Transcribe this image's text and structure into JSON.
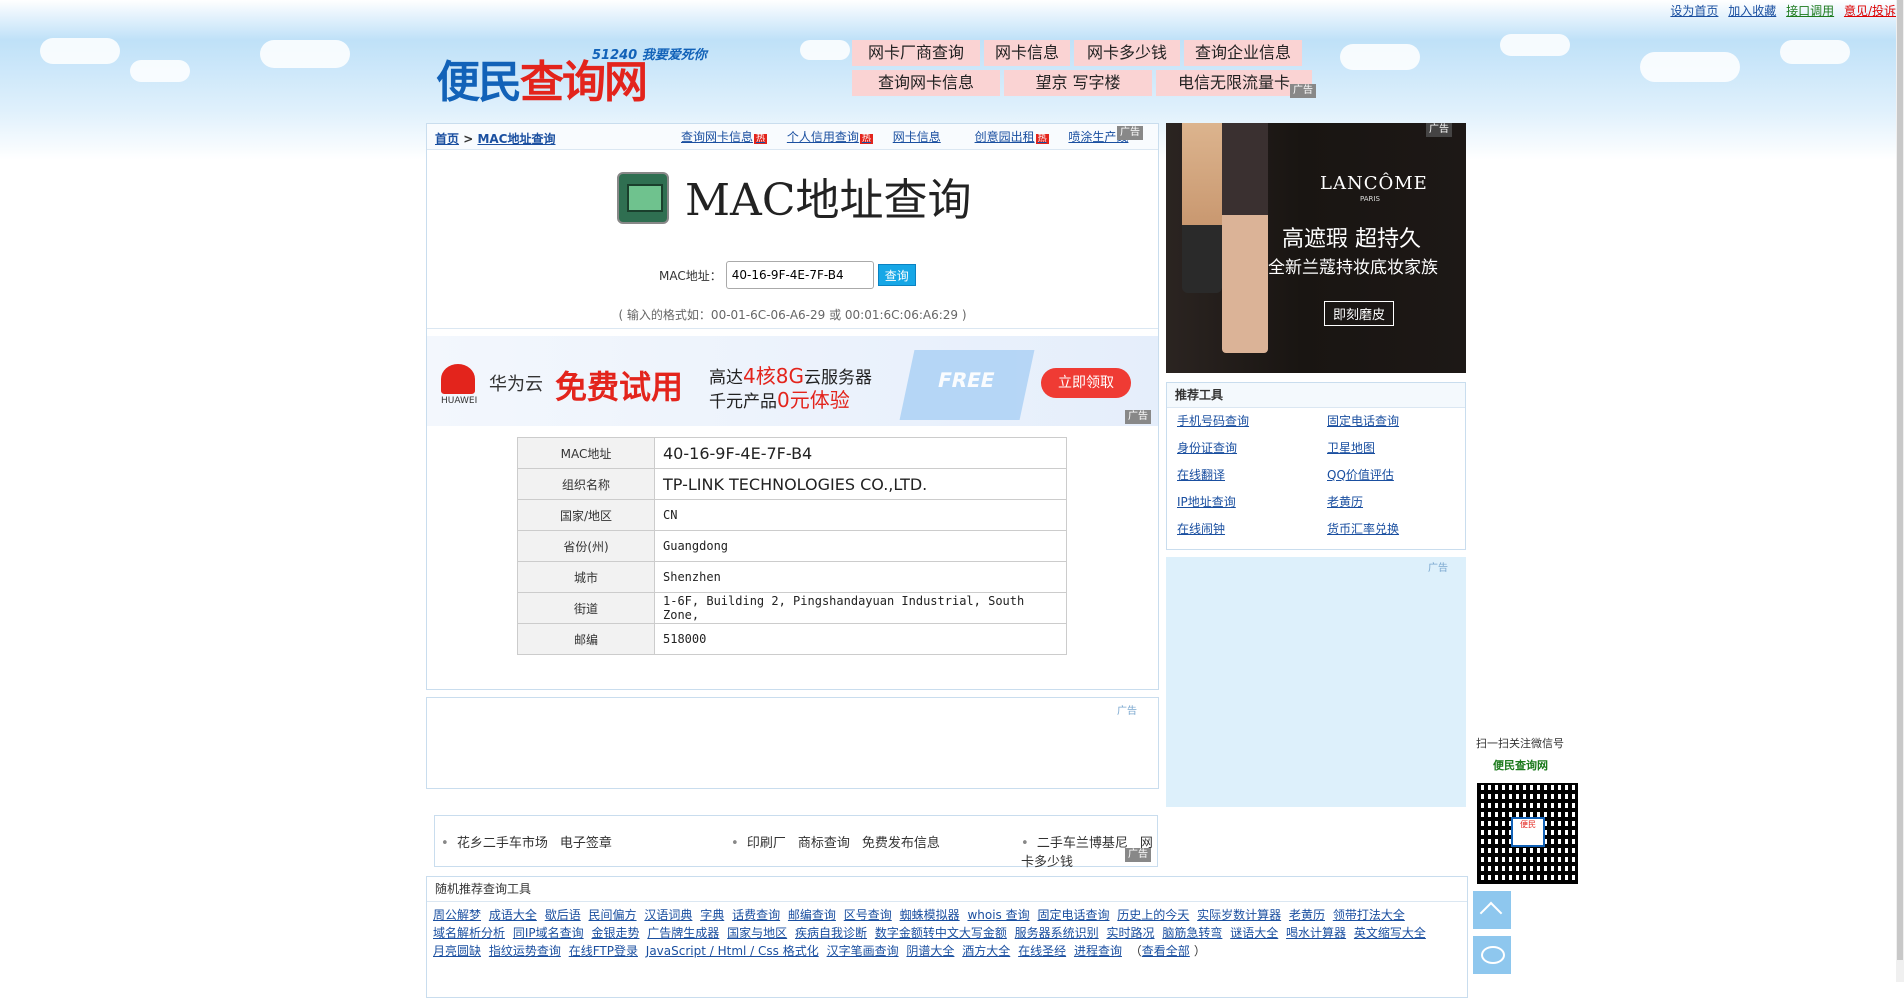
{
  "toplinks": {
    "home": "设为首页",
    "fav": "加入收藏",
    "api": "接口调用",
    "feedback": "意见/投诉"
  },
  "logo": {
    "slogan": "51240 我要爱死你",
    "name_a": "便民",
    "name_b": "查询网"
  },
  "topnav": {
    "row1": [
      "网卡厂商查询",
      "网卡信息",
      "网卡多少钱",
      "查询企业信息"
    ],
    "row2": [
      "查询网卡信息",
      "望京 写字楼",
      "电信无限流量卡"
    ]
  },
  "ad_label": "广告",
  "breadcrumb": {
    "home": "首页",
    "sep": ">",
    "current": "MAC地址查询"
  },
  "quick_links": [
    "查询网卡信息",
    "个人信用查询",
    "网卡信息",
    "创意园出租",
    "喷涂生产线"
  ],
  "hot_badge": "热",
  "page_title": "MAC地址查询",
  "form": {
    "label": "MAC地址：",
    "value": "40-16-9F-4E-7F-B4",
    "button": "查询",
    "hint": "( 输入的格式如：00-01-6C-06-A6-29 或 00:01:6C:06:A6:29 )"
  },
  "banner": {
    "brand": "华为云",
    "brand_en": "HUAWEI",
    "free": "免费试用",
    "line1a": "高达",
    "line1b": "4核8G",
    "line1c": "云服务器",
    "line2a": "千元产品",
    "line2b": "0元体验",
    "cube": "FREE",
    "cta": "立即领取"
  },
  "result": [
    {
      "k": "MAC地址",
      "v": "40-16-9F-4E-7F-B4"
    },
    {
      "k": "组织名称",
      "v": "TP-LINK TECHNOLOGIES CO.,LTD."
    },
    {
      "k": "国家/地区",
      "v": "CN"
    },
    {
      "k": "省份(州)",
      "v": "Guangdong"
    },
    {
      "k": "城市",
      "v": "Shenzhen"
    },
    {
      "k": "街道",
      "v": "1-6F, Building 2, Pingshandayuan Industrial, South Zone,"
    },
    {
      "k": "邮编",
      "v": "518000"
    }
  ],
  "right_ad": {
    "brand": "LANCÔME",
    "paris": "PARIS",
    "t1": "高遮瑕 超持久",
    "t2": "全新兰蔻持妆底妆家族",
    "btn": "即刻磨皮"
  },
  "tools": {
    "title": "推荐工具",
    "items": [
      "手机号码查询",
      "固定电话查询",
      "身份证查询",
      "卫星地图",
      "在线翻译",
      "QQ价值评估",
      "IP地址查询",
      "老黄历",
      "在线闹钟",
      "货币汇率兑换"
    ]
  },
  "qr": {
    "label": "扫一扫关注微信号",
    "name": "便民查询网",
    "center": "便民"
  },
  "linkbar": [
    [
      "花乡二手车市场",
      "电子签章"
    ],
    [
      "印刷厂",
      "商标查询",
      "免费发布信息"
    ],
    [
      "二手车兰博基尼",
      "网卡多少钱"
    ]
  ],
  "random": {
    "title": "随机推荐查询工具",
    "links": [
      "周公解梦",
      "成语大全",
      "歇后语",
      "民间偏方",
      "汉语词典",
      "字典",
      "话费查询",
      "邮编查询",
      "区号查询",
      "蜘蛛模拟器",
      "whois 查询",
      "固定电话查询",
      "历史上的今天",
      "实际岁数计算器",
      "老黄历",
      "领带打法大全",
      "域名解析分析",
      "同IP域名查询",
      "金银走势",
      "广告牌生成器",
      "国家与地区",
      "疾病自我诊断",
      "数字金额转中文大写金额",
      "服务器系统识别",
      "实时路况",
      "脑筋急转弯",
      "谜语大全",
      "喝水计算器",
      "英文缩写大全",
      "月亮圆缺",
      "指纹运势查询",
      "在线FTP登录",
      "JavaScript / Html / Css 格式化",
      "汉字笔画查询",
      "阴谱大全",
      "酒方大全",
      "在线圣经",
      "进程查询"
    ],
    "more": "查看全部",
    "open": "（",
    "close": "）"
  }
}
